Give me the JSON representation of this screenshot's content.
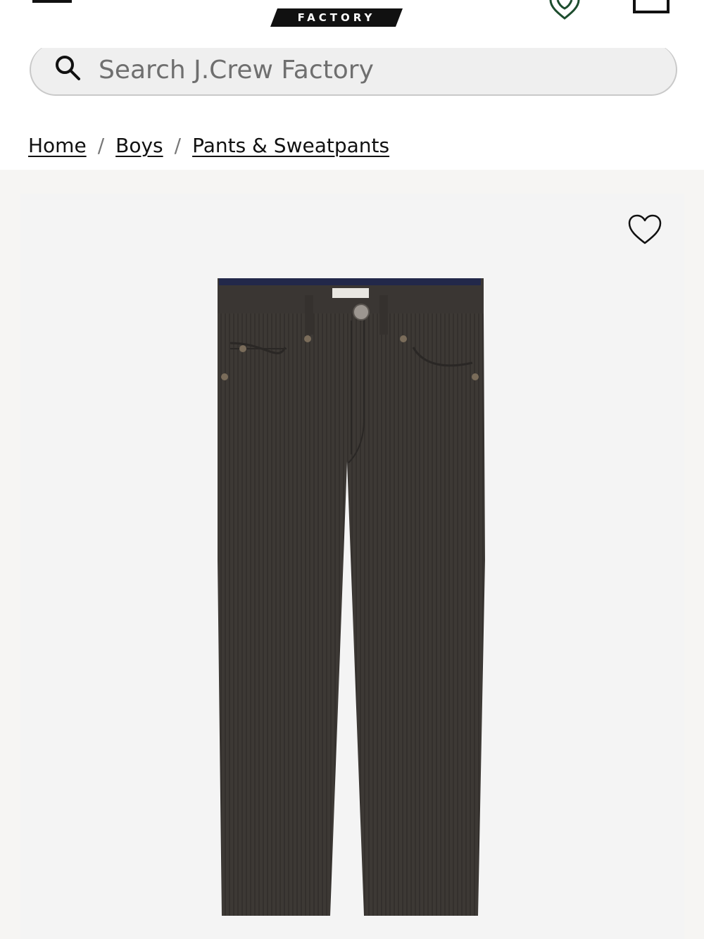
{
  "header": {
    "logo_text": "FACTORY",
    "menu_icon": "hamburger-menu-icon",
    "store_icon": "store-locator-icon",
    "bag_icon": "shopping-bag-icon",
    "accent_color": "#1d4d2e"
  },
  "search": {
    "placeholder": "Search J.Crew Factory",
    "icon": "search-icon"
  },
  "breadcrumb": {
    "items": [
      {
        "label": "Home"
      },
      {
        "label": "Boys"
      },
      {
        "label": "Pants & Sweatpants"
      }
    ],
    "separator": "/"
  },
  "product": {
    "wishlist_icon": "heart-outline-icon",
    "image": "corduroy-pants-image",
    "image_color": "#3d3935"
  }
}
